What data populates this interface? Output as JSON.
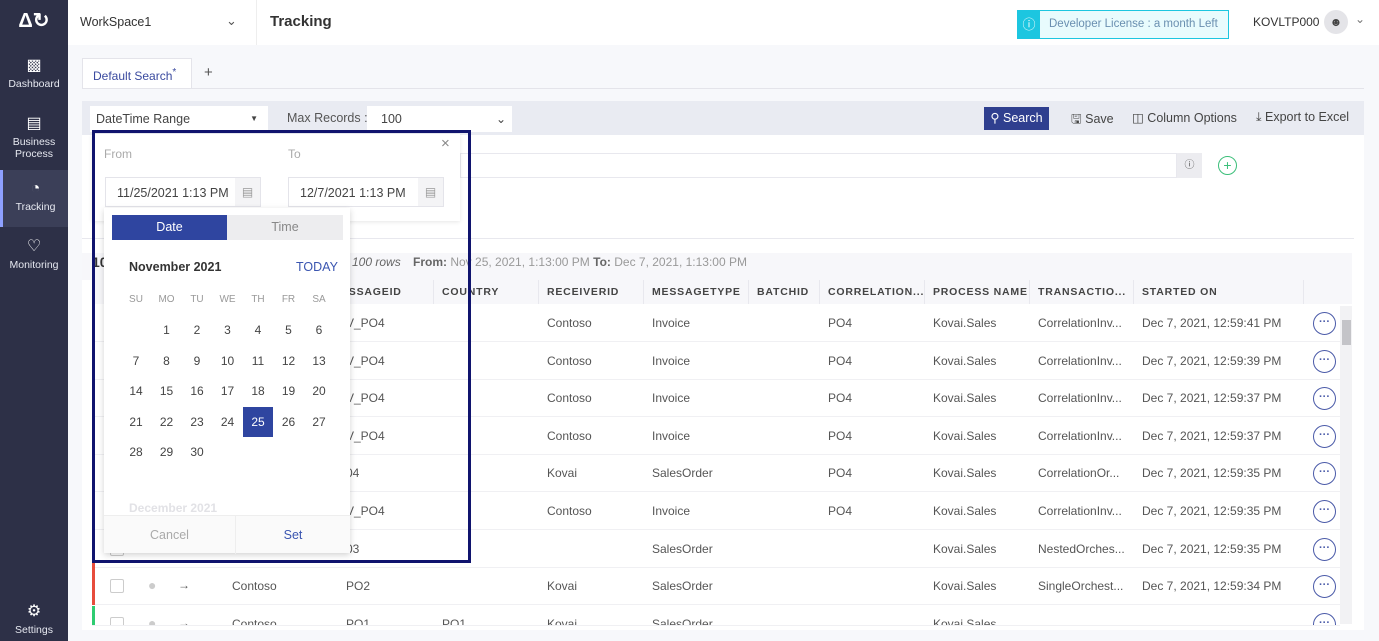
{
  "sidebar": {
    "items": [
      {
        "label": "Dashboard",
        "icon": "chart-icon"
      },
      {
        "label": "Business Process",
        "icon": "list-icon"
      },
      {
        "label": "Tracking",
        "icon": "pie-icon"
      },
      {
        "label": "Monitoring",
        "icon": "heart-icon"
      },
      {
        "label": "Settings",
        "icon": "gear-icon"
      }
    ]
  },
  "header": {
    "workspace": "WorkSpace1",
    "title": "Tracking",
    "license": "Developer License : a month Left",
    "user": "KOVLTP000"
  },
  "tabs": {
    "active": "Default Search",
    "modified_marker": "*",
    "add": "+"
  },
  "toolbar": {
    "filter_type": "DateTime Range",
    "max_records_label": "Max Records :",
    "max_records": "100",
    "search": "Search",
    "save": "Save",
    "column_options": "Column Options",
    "export": "Export to Excel"
  },
  "range_panel": {
    "from_label": "From",
    "to_label": "To",
    "from_value": "11/25/2021 1:13 PM",
    "to_value": "12/7/2021 1:13 PM"
  },
  "calendar": {
    "tab_date": "Date",
    "tab_time": "Time",
    "month": "November 2021",
    "today": "TODAY",
    "weekdays": [
      "SU",
      "MO",
      "TU",
      "WE",
      "TH",
      "FR",
      "SA"
    ],
    "days": [
      "1",
      "2",
      "3",
      "4",
      "5",
      "6",
      "7",
      "8",
      "9",
      "10",
      "11",
      "12",
      "13",
      "14",
      "15",
      "16",
      "17",
      "18",
      "19",
      "20",
      "21",
      "22",
      "23",
      "24",
      "25",
      "26",
      "27",
      "28",
      "29",
      "30"
    ],
    "selected": "25",
    "next_month": "December 2021",
    "cancel": "Cancel",
    "set": "Set"
  },
  "summary": {
    "count_fragment": "10",
    "rows": "100 rows",
    "from_label": "From:",
    "from": "Nov 25, 2021, 1:13:00 PM",
    "to_label": "To:",
    "to": "Dec 7, 2021, 1:13:00 PM"
  },
  "table": {
    "columns": [
      "ESSAGEID",
      "COUNTRY",
      "RECEIVERID",
      "MESSAGETYPE",
      "BATCHID",
      "CORRELATION...",
      "PROCESS NAME",
      "TRANSACTIO...",
      "STARTED ON"
    ],
    "rows": [
      {
        "status": "success",
        "sender": "",
        "messageid": "V_PO4",
        "country": "",
        "receiverid": "Contoso",
        "messagetype": "Invoice",
        "batchid": "",
        "correlation": "PO4",
        "process": "Kovai.Sales",
        "transaction": "CorrelationInv...",
        "started": "Dec 7, 2021, 12:59:41 PM"
      },
      {
        "status": "success",
        "sender": "",
        "messageid": "V_PO4",
        "country": "",
        "receiverid": "Contoso",
        "messagetype": "Invoice",
        "batchid": "",
        "correlation": "PO4",
        "process": "Kovai.Sales",
        "transaction": "CorrelationInv...",
        "started": "Dec 7, 2021, 12:59:39 PM"
      },
      {
        "status": "success",
        "sender": "",
        "messageid": "V_PO4",
        "country": "",
        "receiverid": "Contoso",
        "messagetype": "Invoice",
        "batchid": "",
        "correlation": "PO4",
        "process": "Kovai.Sales",
        "transaction": "CorrelationInv...",
        "started": "Dec 7, 2021, 12:59:37 PM"
      },
      {
        "status": "success",
        "sender": "",
        "messageid": "V_PO4",
        "country": "",
        "receiverid": "Contoso",
        "messagetype": "Invoice",
        "batchid": "",
        "correlation": "PO4",
        "process": "Kovai.Sales",
        "transaction": "CorrelationInv...",
        "started": "Dec 7, 2021, 12:59:37 PM"
      },
      {
        "status": "success",
        "sender": "",
        "messageid": "04",
        "country": "",
        "receiverid": "Kovai",
        "messagetype": "SalesOrder",
        "batchid": "",
        "correlation": "PO4",
        "process": "Kovai.Sales",
        "transaction": "CorrelationOr...",
        "started": "Dec 7, 2021, 12:59:35 PM"
      },
      {
        "status": "success",
        "sender": "",
        "messageid": "V_PO4",
        "country": "",
        "receiverid": "Contoso",
        "messagetype": "Invoice",
        "batchid": "",
        "correlation": "PO4",
        "process": "Kovai.Sales",
        "transaction": "CorrelationInv...",
        "started": "Dec 7, 2021, 12:59:35 PM"
      },
      {
        "status": "error",
        "sender": "",
        "messageid": "03",
        "country": "",
        "receiverid": "",
        "messagetype": "SalesOrder",
        "batchid": "",
        "correlation": "",
        "process": "Kovai.Sales",
        "transaction": "NestedOrches...",
        "started": "Dec 7, 2021, 12:59:35 PM"
      },
      {
        "status": "error",
        "sender": "Contoso",
        "messageid": "PO2",
        "country": "",
        "receiverid": "Kovai",
        "messagetype": "SalesOrder",
        "batchid": "",
        "correlation": "",
        "process": "Kovai.Sales",
        "transaction": "SingleOrchest...",
        "started": "Dec 7, 2021, 12:59:34 PM"
      },
      {
        "status": "success",
        "sender": "Contoso",
        "messageid": "PO1",
        "country": "PO1",
        "receiverid": "Kovai",
        "messagetype": "SalesOrder",
        "batchid": "",
        "correlation": "",
        "process": "Kovai.Sales",
        "transaction": "",
        "started": ""
      }
    ]
  },
  "colors": {
    "sidebar": "#2d3047",
    "accent": "#2f3f9e",
    "success": "#2ecc71",
    "error": "#e74c3c",
    "license": "#1cc6e0"
  }
}
